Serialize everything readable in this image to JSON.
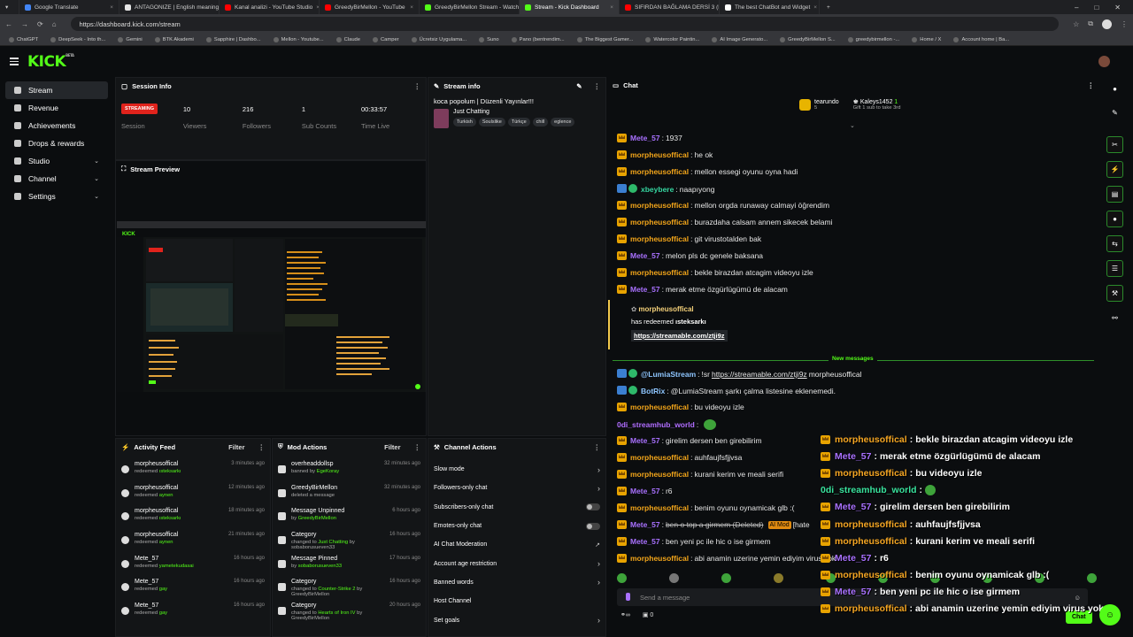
{
  "browser": {
    "tabs": [
      {
        "title": "Google Translate",
        "color": "#4285f4"
      },
      {
        "title": "ANTAGONIZE | English meaning -",
        "color": "#e5e5e5"
      },
      {
        "title": "Kanal analizi - YouTube Studio",
        "color": "#ff0000"
      },
      {
        "title": "GreedyBirMellon - YouTube",
        "color": "#ff0000"
      },
      {
        "title": "GreedyBirMellon Stream - Watch",
        "color": "#53fc18"
      },
      {
        "title": "Stream - Kick Dashboard",
        "color": "#53fc18",
        "active": true
      },
      {
        "title": "SIFIRDAN BAĞLAMA DERSİ 3 (EN",
        "color": "#ff0000"
      },
      {
        "title": "The best ChatBot and Widget",
        "color": "#ffffff"
      }
    ],
    "url": "https://dashboard.kick.com/stream",
    "bookmarks": [
      "ChatGPT",
      "DeepSeek - Into th...",
      "Gemini",
      "BTK Akademi",
      "Sapphire | Dashbo...",
      "Mellon - Youtube...",
      "Claude",
      "Camper",
      "Ücretsiz Uygulama...",
      "Suno",
      "Pano (bentrendim...",
      "The Biggest Gamer...",
      "Watercolor Paintin...",
      "AI Image Generato...",
      "GreedyBirMellon S...",
      "greedybirmellon -...",
      "Home / X",
      "Account home | Ba..."
    ]
  },
  "app": {
    "logo": "KICK",
    "logo_sup": "BETA"
  },
  "sidebar": {
    "items": [
      {
        "label": "Stream",
        "active": true,
        "icon": "broadcast-icon"
      },
      {
        "label": "Revenue",
        "icon": "revenue-icon"
      },
      {
        "label": "Achievements",
        "icon": "trophy-icon"
      },
      {
        "label": "Drops & rewards",
        "icon": "gift-icon"
      },
      {
        "label": "Studio",
        "chevron": true,
        "icon": "studio-icon"
      },
      {
        "label": "Channel",
        "chevron": true,
        "icon": "channel-icon"
      },
      {
        "label": "Settings",
        "chevron": true,
        "icon": "gear-icon"
      }
    ]
  },
  "session": {
    "title": "Session Info",
    "status_badge": "STREAMING",
    "status_label": "Session",
    "stats": [
      {
        "value": "10",
        "label": "Viewers"
      },
      {
        "value": "216",
        "label": "Followers"
      },
      {
        "value": "1",
        "label": "Sub Counts"
      },
      {
        "value": "00:33:57",
        "label": "Time Live"
      }
    ]
  },
  "preview": {
    "title": "Stream Preview"
  },
  "stream_info": {
    "title": "Stream info",
    "stream_title": "koca popolum | Düzenli Yayınlar!!!",
    "category": "Just Chatting",
    "tags": [
      "Turkish",
      "Soulslike",
      "Türkçe",
      "chill",
      "eglence"
    ]
  },
  "activity": {
    "title": "Activity Feed",
    "filter": "Filter",
    "items": [
      {
        "name": "morpheusoffical",
        "action": "redeemed",
        "target": "ısteksarkı",
        "time": "3 minutes ago"
      },
      {
        "name": "morpheusoffical",
        "action": "redeemed",
        "target": "aynen",
        "time": "12 minutes ago"
      },
      {
        "name": "morpheusoffical",
        "action": "redeemed",
        "target": "ısteksarkı",
        "time": "18 minutes ago"
      },
      {
        "name": "morpheusoffical",
        "action": "redeemed",
        "target": "aynen",
        "time": "21 minutes ago"
      },
      {
        "name": "Mete_57",
        "action": "redeemed",
        "target": "yametekudasai",
        "time": "16 hours ago"
      },
      {
        "name": "Mete_57",
        "action": "redeemed",
        "target": "gay",
        "time": "16 hours ago"
      },
      {
        "name": "Mete_57",
        "action": "redeemed",
        "target": "gay",
        "time": "16 hours ago"
      }
    ]
  },
  "mod": {
    "title": "Mod Actions",
    "filter": "Filter",
    "items": [
      {
        "name": "overheaddollsp",
        "sub_pre": "banned by",
        "sub_hl": "EgeKoray",
        "sub_post": "",
        "time": "32 minutes ago"
      },
      {
        "name": "GreedyBirMellon",
        "sub_pre": "deleted a message",
        "sub_hl": "",
        "sub_post": "",
        "time": "32 minutes ago"
      },
      {
        "name": "Message Unpinned",
        "sub_pre": "by",
        "sub_hl": "GreedyBirMellon",
        "sub_post": "",
        "time": "6 hours ago"
      },
      {
        "name": "Category",
        "sub_pre": "changed to",
        "sub_hl": "Just Chatting",
        "sub_post": "by sobaborusueven33",
        "time": "16 hours ago"
      },
      {
        "name": "Message Pinned",
        "sub_pre": "by",
        "sub_hl": "sobaborusueven33",
        "sub_post": "",
        "time": "17 hours ago"
      },
      {
        "name": "Category",
        "sub_pre": "changed to",
        "sub_hl": "Counter-Strike 2",
        "sub_post": "by GreedyBirMellon",
        "time": "16 hours ago"
      },
      {
        "name": "Category",
        "sub_pre": "changed to",
        "sub_hl": "Hearts of Iron IV",
        "sub_post": "by GreedyBirMellon",
        "time": "20 hours ago"
      }
    ]
  },
  "channel_actions": {
    "title": "Channel Actions",
    "items": [
      {
        "label": "Slow mode",
        "type": "arrow"
      },
      {
        "label": "Followers-only chat",
        "type": "arrow"
      },
      {
        "label": "Subscribers-only chat",
        "type": "toggle"
      },
      {
        "label": "Emotes-only chat",
        "type": "toggle"
      },
      {
        "label": "AI Chat Moderation",
        "type": "ext"
      },
      {
        "label": "Account age restriction",
        "type": "arrow"
      },
      {
        "label": "Banned words",
        "type": "arrow"
      },
      {
        "label": "Host Channel",
        "type": "none"
      },
      {
        "label": "Set goals",
        "type": "arrow"
      }
    ]
  },
  "chat": {
    "title": "Chat",
    "gifters": [
      {
        "name": "tearundo",
        "count": "5"
      },
      {
        "name": "Kaleys1452",
        "count": "1",
        "sub": "Gift 1 sub to take 3rd"
      }
    ],
    "messages": [
      {
        "user": "Mete_57",
        "color": "p",
        "badge": "crown",
        "text": "1937"
      },
      {
        "user": "morpheusoffical",
        "color": "o",
        "badge": "crown",
        "text": "he ok"
      },
      {
        "user": "morpheusoffical",
        "color": "o",
        "badge": "crown",
        "text": "mellon essegi oyunu oyna hadi"
      },
      {
        "user": "xbeybere",
        "color": "g",
        "badge": "verified",
        "text": "naapıyong"
      },
      {
        "user": "morpheusoffical",
        "color": "o",
        "badge": "crown",
        "text": "mellon orgda runaway calmayi öğrendim"
      },
      {
        "user": "morpheusoffical",
        "color": "o",
        "badge": "crown",
        "text": "burazdaha calsam annem sikecek belami"
      },
      {
        "user": "morpheusoffical",
        "color": "o",
        "badge": "crown",
        "text": "git virustotalden bak"
      },
      {
        "user": "Mete_57",
        "color": "p",
        "badge": "crown",
        "text": "melon pls dc genele baksana"
      },
      {
        "user": "morpheusoffical",
        "color": "o",
        "badge": "crown",
        "text": "bekle birazdan atcagim videoyu izle"
      },
      {
        "user": "Mete_57",
        "color": "p",
        "badge": "crown",
        "text": "merak etme özgürlügümü de alacam"
      }
    ],
    "redeem": {
      "user": "morpheusoffical",
      "action": "has redeemed",
      "reward": "ısteksarkı",
      "link": "https://streamable.com/ztji9z"
    },
    "new_messages_label": "New messages",
    "messages2": [
      {
        "user": "@LumiaStream",
        "color": "c",
        "badge": "bot",
        "text": "!sr ",
        "link": "https://streamable.com/ztji9z",
        "after": " morpheusoffical"
      },
      {
        "user": "BotRix",
        "color": "c",
        "badge": "bot",
        "text": "@LumiaStream şarkı çalma listesine eklenemedi."
      },
      {
        "user": "morpheusoffical",
        "color": "o",
        "badge": "crown",
        "text": "bu videoyu izle"
      },
      {
        "user": "0di_streamhub_world",
        "color": "v",
        "badge": "none",
        "text": "",
        "emote": true
      },
      {
        "user": "Mete_57",
        "color": "p",
        "badge": "crown",
        "text": "girelim dersen ben girebilirim"
      },
      {
        "user": "morpheusoffical",
        "color": "o",
        "badge": "crown",
        "text": "auhfaujfsfjjvsa"
      },
      {
        "user": "morpheusoffical",
        "color": "o",
        "badge": "crown",
        "text": "kurani kerim ve meali serifi"
      },
      {
        "user": "Mete_57",
        "color": "p",
        "badge": "crown",
        "text": "r6"
      },
      {
        "user": "morpheusoffical",
        "color": "o",
        "badge": "crown",
        "text": "benim oyunu oynamicak glb :("
      },
      {
        "user": "Mete_57",
        "color": "p",
        "badge": "crown",
        "text": "",
        "strike": "ben o top a girmem (Deleted)",
        "tag": "AI Mod",
        "after": " [hate"
      },
      {
        "user": "Mete_57",
        "color": "p",
        "badge": "crown",
        "text": "ben yeni pc ile hic o ise girmem"
      },
      {
        "user": "morpheusoffical",
        "color": "o",
        "badge": "crown",
        "text": "abi anamin uzerine yemin ediyim virus yok"
      }
    ],
    "send_placeholder": "Send a message",
    "viewer_count": "0",
    "chat_button": "Chat"
  },
  "overlay": {
    "messages": [
      {
        "user": "morpheusoffical",
        "color": "o",
        "badge": "crown",
        "text": "bekle birazdan atcagim videoyu izle"
      },
      {
        "user": "Mete_57",
        "color": "p",
        "badge": "crown",
        "text": "merak etme özgürlügümü de alacam"
      },
      {
        "user": "morpheusoffical",
        "color": "o",
        "badge": "crown",
        "text": "bu videoyu izle"
      },
      {
        "user": "0di_streamhub_world",
        "color": "g",
        "badge": "none",
        "text": "",
        "emote": true
      },
      {
        "user": "Mete_57",
        "color": "p",
        "badge": "crown",
        "text": "girelim dersen ben girebilirim"
      },
      {
        "user": "morpheusoffical",
        "color": "o",
        "badge": "crown",
        "text": "auhfaujfsfjjvsa"
      },
      {
        "user": "morpheusoffical",
        "color": "o",
        "badge": "crown",
        "text": "kurani kerim ve meali serifi"
      },
      {
        "user": "Mete_57",
        "color": "p",
        "badge": "crown",
        "text": "r6"
      },
      {
        "user": "morpheusoffical",
        "color": "o",
        "badge": "crown",
        "text": "benim oyunu oynamicak glb :("
      },
      {
        "user": "Mete_57",
        "color": "p",
        "badge": "crown",
        "text": "ben yeni pc ile hic o ise girmem"
      },
      {
        "user": "morpheusoffical",
        "color": "o",
        "badge": "crown",
        "text": "abi anamin uzerine yemin ediyim virus yok"
      }
    ]
  },
  "colors": {
    "accent": "#53fc18",
    "live": "#e0231c",
    "bg": "#0b0d0f",
    "panel": "#131517"
  }
}
